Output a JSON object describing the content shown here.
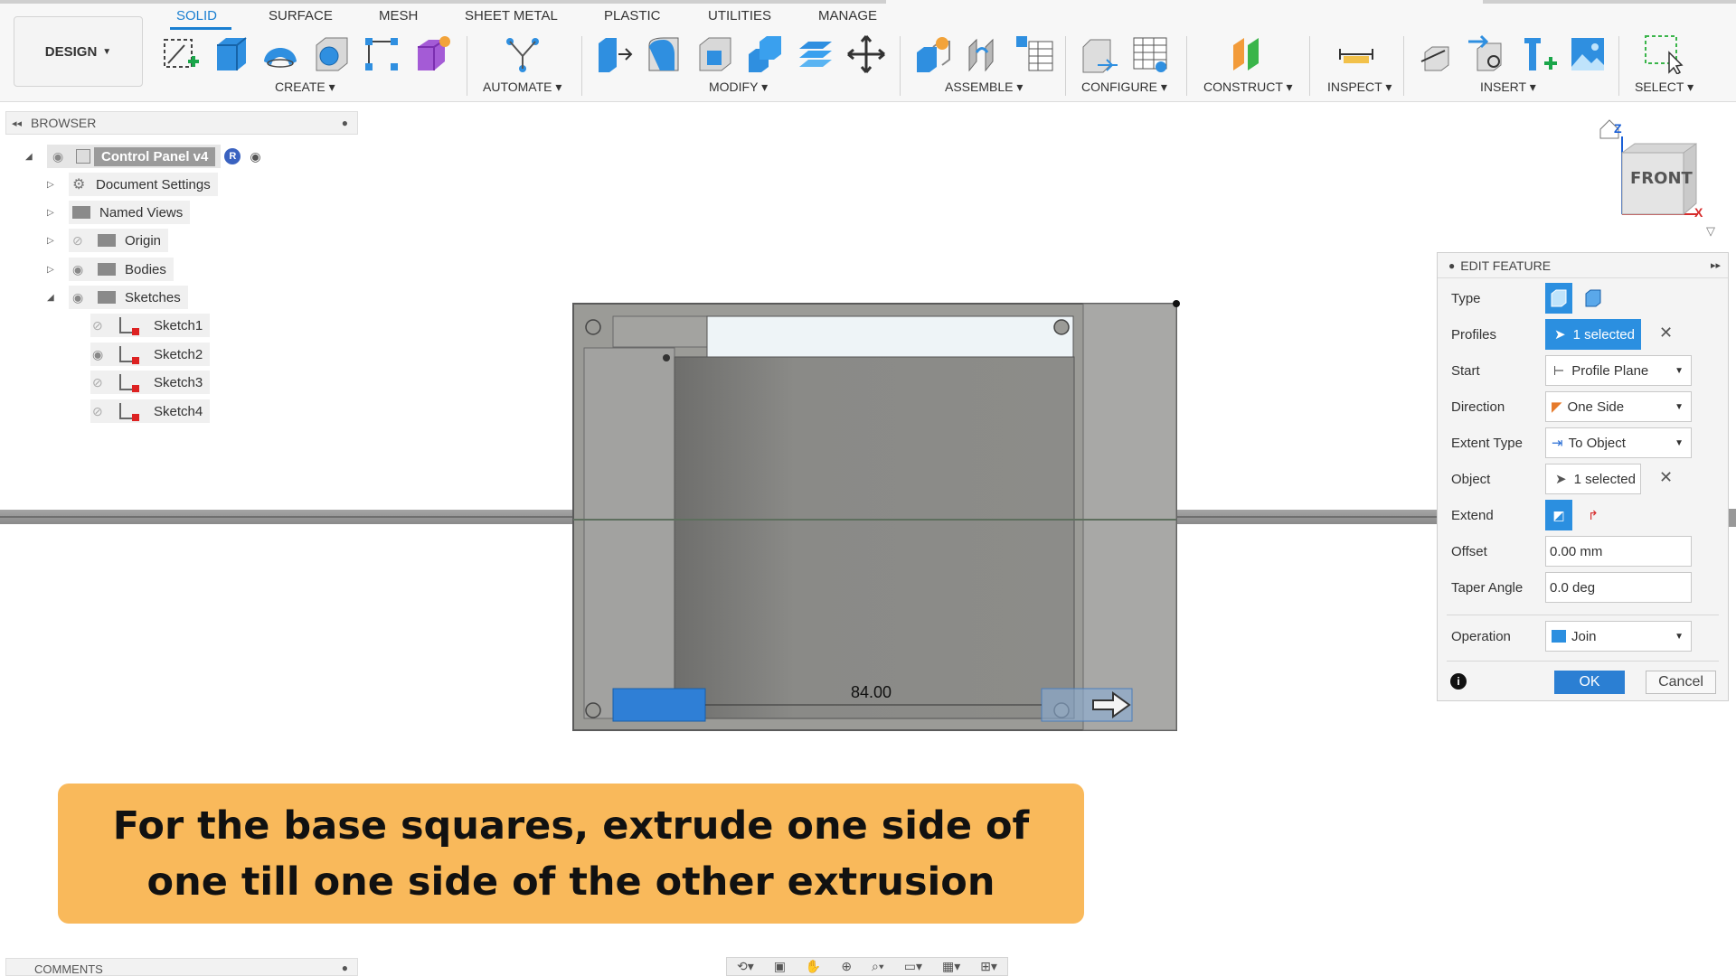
{
  "toolbar": {
    "design_label": "DESIGN",
    "tabs": [
      "SOLID",
      "SURFACE",
      "MESH",
      "SHEET METAL",
      "PLASTIC",
      "UTILITIES",
      "MANAGE"
    ],
    "active_tab": "SOLID",
    "groups": {
      "create": "CREATE",
      "automate": "AUTOMATE",
      "modify": "MODIFY",
      "assemble": "ASSEMBLE",
      "configure": "CONFIGURE",
      "construct": "CONSTRUCT",
      "inspect": "INSPECT",
      "insert": "INSERT",
      "select": "SELECT"
    },
    "accent_color": "#1a7fd1"
  },
  "browser": {
    "title": "BROWSER",
    "root": "Control Panel v4",
    "root_badge": "R",
    "items": [
      {
        "label": "Document Settings",
        "icon": "gear-icon"
      },
      {
        "label": "Named Views",
        "icon": "folder-icon"
      },
      {
        "label": "Origin",
        "icon": "folder-icon"
      },
      {
        "label": "Bodies",
        "icon": "folder-icon"
      },
      {
        "label": "Sketches",
        "icon": "folder-icon"
      }
    ],
    "sketches": [
      "Sketch1",
      "Sketch2",
      "Sketch3",
      "Sketch4"
    ]
  },
  "viewcube": {
    "face": "FRONT",
    "axis_z": "Z",
    "axis_x": "X"
  },
  "viewport": {
    "dimension": "84.00"
  },
  "edit_feature": {
    "title": "EDIT FEATURE",
    "type_label": "Type",
    "profiles_label": "Profiles",
    "profiles_value": "1 selected",
    "start_label": "Start",
    "start_value": "Profile Plane",
    "direction_label": "Direction",
    "direction_value": "One Side",
    "extent_type_label": "Extent Type",
    "extent_type_value": "To Object",
    "object_label": "Object",
    "object_value": "1 selected",
    "extend_label": "Extend",
    "offset_label": "Offset",
    "offset_value": "0.00 mm",
    "taper_label": "Taper Angle",
    "taper_value": "0.0 deg",
    "operation_label": "Operation",
    "operation_value": "Join",
    "ok_label": "OK",
    "cancel_label": "Cancel"
  },
  "caption": {
    "text": "For the base squares, extrude one side of one till one side of the other extrusion"
  },
  "bottom": {
    "comments_label": "COMMENTS"
  }
}
